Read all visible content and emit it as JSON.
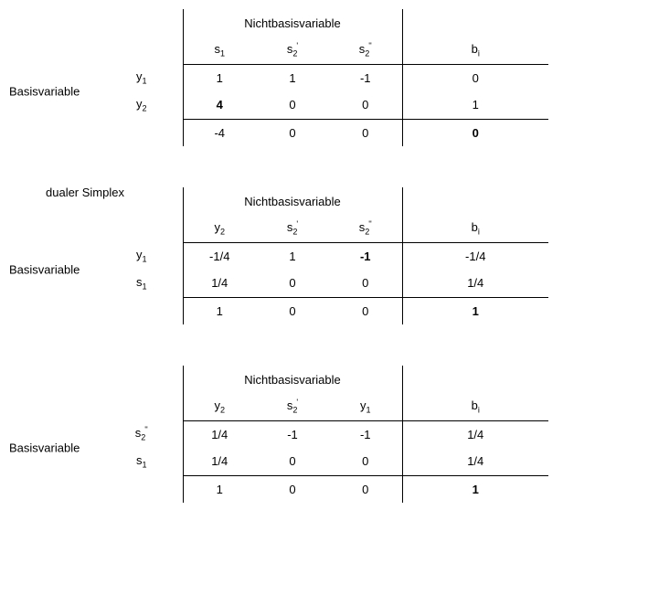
{
  "labels": {
    "nonbasis": "Nichtbasisvariable",
    "basis": "Basisvariable",
    "dual": "dualer Simplex",
    "bi": "b<sub>i</sub>"
  },
  "tableaus": [
    {
      "extra_label": "",
      "cols": [
        "s<sub>1</sub>",
        "s<sub>2</sub><span class='tick1'>'</span>",
        "s<sub>2</sub><span class='tick2'>''</span>"
      ],
      "rows": [
        {
          "label": "y<sub>1</sub>",
          "vals": [
            "1",
            "1",
            "-1"
          ],
          "b": "0"
        },
        {
          "label": "y<sub>2</sub>",
          "vals": [
            "<span class='bold'>4</span>",
            "0",
            "0"
          ],
          "b": "1"
        }
      ],
      "obj": {
        "vals": [
          "-4",
          "0",
          "0"
        ],
        "b": "<span class='bold'>0</span>"
      }
    },
    {
      "extra_label": "dualer Simplex",
      "cols": [
        "y<sub>2</sub>",
        "s<sub>2</sub><span class='tick1'>'</span>",
        "s<sub>2</sub><span class='tick2'>''</span>"
      ],
      "rows": [
        {
          "label": "y<sub>1</sub>",
          "vals": [
            "-1/4",
            "1",
            "<span class='bold'>-1</span>"
          ],
          "b": "-1/4"
        },
        {
          "label": "s<sub>1</sub>",
          "vals": [
            "1/4",
            "0",
            "0"
          ],
          "b": "1/4"
        }
      ],
      "obj": {
        "vals": [
          "1",
          "0",
          "0"
        ],
        "b": "<span class='bold'>1</span>"
      }
    },
    {
      "extra_label": "",
      "cols": [
        "y<sub>2</sub>",
        "s<sub>2</sub><span class='tick1'>'</span>",
        "y<sub>1</sub>"
      ],
      "rows": [
        {
          "label": "s<sub>2</sub><span class='tick2'>''</span>",
          "vals": [
            "1/4",
            "-1",
            "-1"
          ],
          "b": "1/4"
        },
        {
          "label": "s<sub>1</sub>",
          "vals": [
            "1/4",
            "0",
            "0"
          ],
          "b": "1/4"
        }
      ],
      "obj": {
        "vals": [
          "1",
          "0",
          "0"
        ],
        "b": "<span class='bold'>1</span>"
      }
    }
  ]
}
